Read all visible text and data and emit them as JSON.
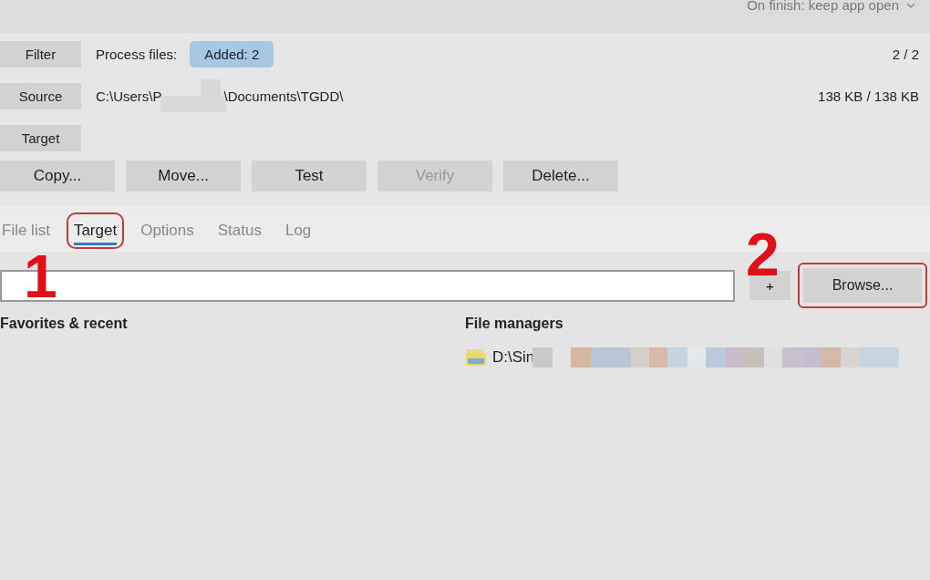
{
  "top_bar": {
    "on_finish": "On finish: keep app open"
  },
  "rows": [
    {
      "button": "Filter",
      "text": "Process files:",
      "badge": "Added: 2",
      "right": "2 / 2"
    },
    {
      "button": "Source",
      "text": "C:\\Users\\P",
      "text_after": "\\Documents\\TGDD\\",
      "right": "138 KB / 138 KB",
      "redacted": true
    },
    {
      "button": "Target"
    }
  ],
  "actions": [
    {
      "label": "Copy...",
      "disabled": false
    },
    {
      "label": "Move...",
      "disabled": false
    },
    {
      "label": "Test",
      "disabled": false
    },
    {
      "label": "Verify",
      "disabled": true
    },
    {
      "label": "Delete...",
      "disabled": false
    }
  ],
  "tabs": [
    {
      "label": "File list",
      "selected": false,
      "highlighted": false
    },
    {
      "label": "Target",
      "selected": true,
      "highlighted": true
    },
    {
      "label": "Options",
      "selected": false,
      "highlighted": false
    },
    {
      "label": "Status",
      "selected": false,
      "highlighted": false
    },
    {
      "label": "Log",
      "selected": false,
      "highlighted": false
    }
  ],
  "target_field": {
    "add_button": "+",
    "browse_button": {
      "label": "Browse...",
      "highlighted": true
    }
  },
  "favorites": {
    "heading": "Favorites & recent"
  },
  "file_managers": {
    "heading": "File managers",
    "items": [
      {
        "text": "D:\\Sin",
        "redacted": true
      }
    ]
  },
  "annotations": [
    {
      "kind": "step-number",
      "text": "1"
    },
    {
      "kind": "step-number",
      "text": "2"
    }
  ]
}
